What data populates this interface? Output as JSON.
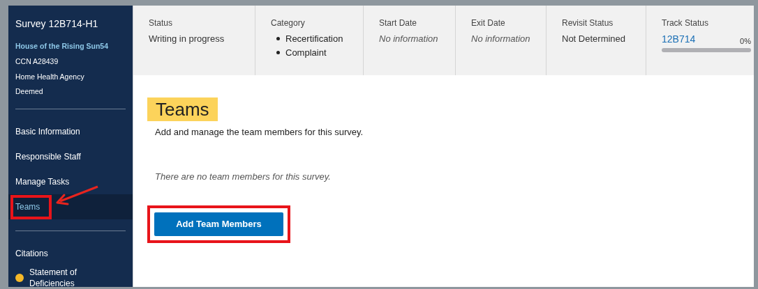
{
  "sidebar": {
    "title": "Survey 12B714-H1",
    "provider": "House of the Rising Sun54",
    "details": [
      "CCN A28439",
      "Home Health Agency",
      "Deemed"
    ],
    "nav_groups": [
      [
        {
          "label": "Basic Information",
          "selected": false
        },
        {
          "label": "Responsible Staff",
          "selected": false
        },
        {
          "label": "Manage Tasks",
          "selected": false
        },
        {
          "label": "Teams",
          "selected": true
        }
      ],
      [
        {
          "label": "Citations",
          "selected": false
        },
        {
          "label": "Statement of Deficiencies",
          "selected": false,
          "color": "#f5b829"
        }
      ]
    ]
  },
  "summary": [
    {
      "kind": "text",
      "label": "Status",
      "value": "Writing in progress"
    },
    {
      "kind": "list",
      "label": "Category",
      "items": [
        "Recertification",
        "Complaint"
      ]
    },
    {
      "kind": "empty",
      "label": "Start Date",
      "value": "No information"
    },
    {
      "kind": "empty",
      "label": "Exit Date",
      "value": "No information"
    },
    {
      "kind": "text",
      "label": "Revisit Status",
      "value": "Not Determined"
    },
    {
      "kind": "progress",
      "label": "Track Status",
      "link": "12B714",
      "reading": "0%",
      "level": 0
    }
  ],
  "page": {
    "title": "Teams",
    "description": "Add and manage the team members for this survey.",
    "empty_message": "There are no team members for this survey.",
    "button": "Add Team Members"
  }
}
